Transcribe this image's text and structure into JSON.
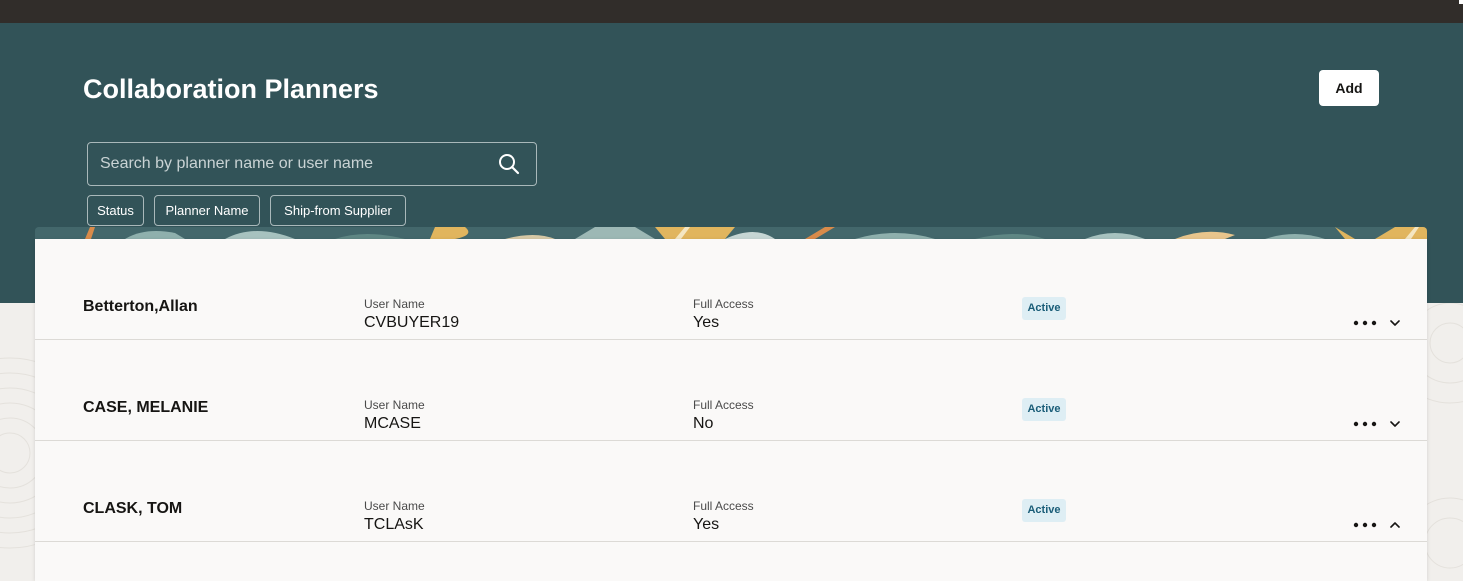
{
  "header": {
    "title": "Collaboration Planners",
    "add_label": "Add"
  },
  "search": {
    "placeholder": "Search by planner name or user name",
    "value": ""
  },
  "filters": [
    "Status",
    "Planner Name",
    "Ship-from Supplier"
  ],
  "rows": [
    {
      "name": "Betterton,Allan",
      "user_name_label": "User Name",
      "user_name": "CVBUYER19",
      "full_access_label": "Full Access",
      "full_access": "Yes",
      "status": "Active",
      "expanded": false
    },
    {
      "name": "CASE, MELANIE",
      "user_name_label": "User Name",
      "user_name": "MCASE",
      "full_access_label": "Full Access",
      "full_access": "No",
      "status": "Active",
      "expanded": false
    },
    {
      "name": "CLASK, TOM",
      "user_name_label": "User Name",
      "user_name": "TCLAsK",
      "full_access_label": "Full Access",
      "full_access": "Yes",
      "status": "Active",
      "expanded": true
    }
  ],
  "icons": {
    "search": "search-icon",
    "more": "more-actions-icon",
    "expand": "chevron-down-icon",
    "collapse": "chevron-up-icon"
  },
  "colors": {
    "header_bg": "#325358",
    "topbar_bg": "#312d2a",
    "status_badge_bg": "#deeef4",
    "status_badge_text": "#1a5d78"
  }
}
